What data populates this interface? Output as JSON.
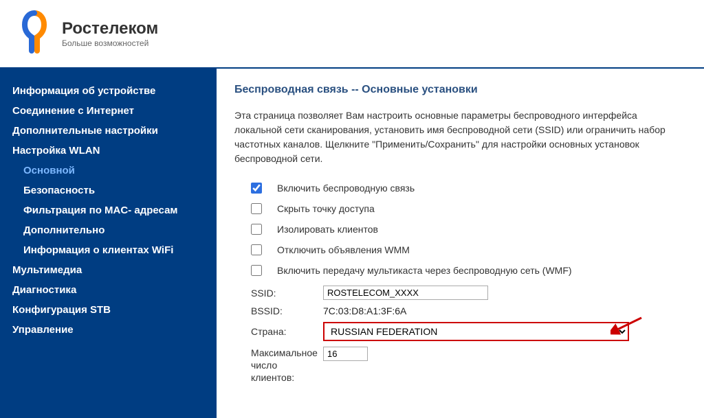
{
  "brand": {
    "name": "Ростелеком",
    "slogan": "Больше возможностей"
  },
  "sidebar": {
    "items": [
      {
        "label": "Информация об устройстве",
        "sub": false
      },
      {
        "label": "Соединение с Интернет",
        "sub": false
      },
      {
        "label": "Дополнительные настройки",
        "sub": false
      },
      {
        "label": "Настройка WLAN",
        "sub": false
      },
      {
        "label": "Основной",
        "sub": true,
        "active": true
      },
      {
        "label": "Безопасность",
        "sub": true
      },
      {
        "label": "Фильтрация по MAC- адресам",
        "sub": true
      },
      {
        "label": "Дополнительно",
        "sub": true
      },
      {
        "label": "Информация о клиентах WiFi",
        "sub": true
      },
      {
        "label": "Мультимедиа",
        "sub": false
      },
      {
        "label": "Диагностика",
        "sub": false
      },
      {
        "label": "Конфигурация STB",
        "sub": false
      },
      {
        "label": "Управление",
        "sub": false
      }
    ]
  },
  "page": {
    "title": "Беспроводная связь -- Основные установки",
    "description": "Эта страница позволяет Вам настроить основные параметры беспроводного интерфейса локальной сети сканирования, установить имя беспроводной сети (SSID) или ограничить набор частотных каналов. Щелкните \"Применить/Сохранить\" для настройки основных установок беспроводной сети."
  },
  "checkboxes": {
    "enable_wireless": {
      "label": "Включить беспроводную связь",
      "checked": true
    },
    "hide_ap": {
      "label": "Скрыть точку доступа",
      "checked": false
    },
    "isolate": {
      "label": "Изолировать клиентов",
      "checked": false
    },
    "disable_wmm": {
      "label": "Отключить объявления WMM",
      "checked": false
    },
    "enable_wmf": {
      "label": "Включить передачу мультикаста через беспроводную сеть (WMF)",
      "checked": false
    }
  },
  "fields": {
    "ssid": {
      "label": "SSID:",
      "value": "ROSTELECOM_XXXX"
    },
    "bssid": {
      "label": "BSSID:",
      "value": "7C:03:D8:A1:3F:6A"
    },
    "country": {
      "label": "Страна:",
      "value": "RUSSIAN FEDERATION"
    },
    "max_clients": {
      "label": "Максимальное число клиентов:",
      "value": "16"
    }
  }
}
